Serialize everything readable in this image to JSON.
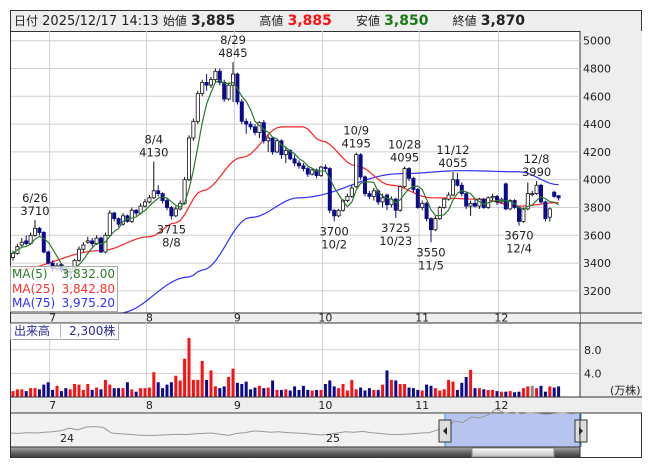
{
  "header": {
    "date_label": "日付",
    "date_value": "2025/12/17 14:13",
    "open_label": "始値",
    "open_value": "3,885",
    "high_label": "高値",
    "high_value": "3,885",
    "low_label": "安値",
    "low_value": "3,850",
    "close_label": "終値",
    "close_value": "3,870"
  },
  "legend": {
    "ma5_label": "MA(5)",
    "ma5_value": "3,832.00",
    "ma25_label": "MA(25)",
    "ma25_value": "3,842.80",
    "ma75_label": "MA(75)",
    "ma75_value": "3,975.20"
  },
  "volume_label": {
    "label": "出来高",
    "value": "2,300株"
  },
  "colors": {
    "up_fill": "#ffffff",
    "down_fill": "#0a0a8c",
    "ma5": "#2a7a2a",
    "ma25": "#ff2020",
    "ma75": "#3030ff",
    "vol_up": "#ff1010",
    "vol_down": "#0a0a8c",
    "vol_flat": "#888888"
  },
  "chart_data": {
    "type": "candlestick",
    "price_axis": {
      "min": 3100,
      "max": 5050,
      "ticks": [
        "5000",
        "4800",
        "4600",
        "4400",
        "4200",
        "4000",
        "3800",
        "3600",
        "3400",
        "3200"
      ]
    },
    "volume_axis": {
      "min": 0,
      "max": 11,
      "ticks": [
        "8.0",
        "4.0"
      ],
      "unit": "(万株)"
    },
    "months": [
      {
        "label": "7",
        "index": 9
      },
      {
        "label": "8",
        "index": 31
      },
      {
        "label": "9",
        "index": 51
      },
      {
        "label": "10",
        "index": 71
      },
      {
        "label": "11",
        "index": 93
      },
      {
        "label": "12",
        "index": 111
      }
    ],
    "ohlc": [
      [
        3440,
        3490,
        3420,
        3470
      ],
      [
        3470,
        3540,
        3460,
        3520
      ],
      [
        3530,
        3580,
        3510,
        3550
      ],
      [
        3560,
        3600,
        3530,
        3540
      ],
      [
        3540,
        3620,
        3530,
        3600
      ],
      [
        3600,
        3710,
        3590,
        3650
      ],
      [
        3650,
        3660,
        3600,
        3620
      ],
      [
        3620,
        3630,
        3470,
        3480
      ],
      [
        3480,
        3490,
        3390,
        3400
      ],
      [
        3400,
        3420,
        3340,
        3360
      ],
      [
        3360,
        3400,
        3340,
        3380
      ],
      [
        3390,
        3400,
        3330,
        3350
      ],
      [
        3350,
        3360,
        3300,
        3330
      ],
      [
        3330,
        3360,
        3310,
        3340
      ],
      [
        3340,
        3430,
        3330,
        3420
      ],
      [
        3420,
        3520,
        3410,
        3500
      ],
      [
        3500,
        3550,
        3480,
        3530
      ],
      [
        3550,
        3590,
        3540,
        3560
      ],
      [
        3560,
        3580,
        3520,
        3540
      ],
      [
        3540,
        3600,
        3530,
        3580
      ],
      [
        3580,
        3590,
        3470,
        3480
      ],
      [
        3480,
        3620,
        3470,
        3600
      ],
      [
        3600,
        3780,
        3590,
        3760
      ],
      [
        3760,
        3770,
        3700,
        3720
      ],
      [
        3720,
        3730,
        3660,
        3680
      ],
      [
        3680,
        3760,
        3670,
        3740
      ],
      [
        3740,
        3750,
        3690,
        3700
      ],
      [
        3700,
        3800,
        3690,
        3780
      ],
      [
        3780,
        3790,
        3740,
        3760
      ],
      [
        3760,
        3830,
        3750,
        3810
      ],
      [
        3810,
        3860,
        3800,
        3840
      ],
      [
        3840,
        3890,
        3830,
        3870
      ],
      [
        3870,
        4130,
        3860,
        3920
      ],
      [
        3920,
        3960,
        3880,
        3900
      ],
      [
        3900,
        3910,
        3830,
        3850
      ],
      [
        3850,
        3870,
        3780,
        3800
      ],
      [
        3800,
        3810,
        3715,
        3740
      ],
      [
        3740,
        3810,
        3730,
        3790
      ],
      [
        3790,
        3850,
        3780,
        3830
      ],
      [
        3830,
        4020,
        3820,
        4000
      ],
      [
        4000,
        4320,
        3990,
        4300
      ],
      [
        4300,
        4440,
        4280,
        4420
      ],
      [
        4420,
        4640,
        4400,
        4620
      ],
      [
        4620,
        4720,
        4600,
        4700
      ],
      [
        4700,
        4760,
        4640,
        4680
      ],
      [
        4680,
        4740,
        4660,
        4720
      ],
      [
        4720,
        4800,
        4700,
        4780
      ],
      [
        4780,
        4800,
        4680,
        4700
      ],
      [
        4700,
        4720,
        4560,
        4580
      ],
      [
        4580,
        4700,
        4570,
        4680
      ],
      [
        4680,
        4845,
        4560,
        4760
      ],
      [
        4760,
        4770,
        4540,
        4560
      ],
      [
        4560,
        4580,
        4400,
        4420
      ],
      [
        4420,
        4440,
        4330,
        4400
      ],
      [
        4400,
        4420,
        4360,
        4380
      ],
      [
        4380,
        4400,
        4320,
        4340
      ],
      [
        4340,
        4420,
        4300,
        4410
      ],
      [
        4410,
        4430,
        4260,
        4280
      ],
      [
        4280,
        4320,
        4200,
        4300
      ],
      [
        4300,
        4310,
        4180,
        4200
      ],
      [
        4200,
        4290,
        4190,
        4280
      ],
      [
        4280,
        4290,
        4150,
        4180
      ],
      [
        4180,
        4230,
        4120,
        4210
      ],
      [
        4210,
        4220,
        4140,
        4150
      ],
      [
        4150,
        4180,
        4100,
        4120
      ],
      [
        4120,
        4140,
        4080,
        4100
      ],
      [
        4100,
        4120,
        4060,
        4080
      ],
      [
        4080,
        4090,
        4020,
        4040
      ],
      [
        4040,
        4080,
        4030,
        4070
      ],
      [
        4070,
        4080,
        4010,
        4030
      ],
      [
        4030,
        4100,
        4020,
        4090
      ],
      [
        4090,
        4110,
        4060,
        4080
      ],
      [
        4080,
        4090,
        3760,
        3780
      ],
      [
        3780,
        3790,
        3700,
        3740
      ],
      [
        3740,
        3790,
        3730,
        3780
      ],
      [
        3780,
        3860,
        3770,
        3850
      ],
      [
        3850,
        3900,
        3840,
        3880
      ],
      [
        3880,
        3960,
        3870,
        3940
      ],
      [
        3950,
        4195,
        3940,
        4180
      ],
      [
        4180,
        4190,
        4000,
        4020
      ],
      [
        4020,
        4030,
        3880,
        3900
      ],
      [
        3900,
        3920,
        3860,
        3880
      ],
      [
        3880,
        3940,
        3850,
        3920
      ],
      [
        3920,
        3930,
        3820,
        3840
      ],
      [
        3840,
        3900,
        3800,
        3870
      ],
      [
        3890,
        3900,
        3780,
        3820
      ],
      [
        3820,
        3880,
        3800,
        3860
      ],
      [
        3860,
        3870,
        3725,
        3780
      ],
      [
        3780,
        3960,
        3770,
        3950
      ],
      [
        3950,
        4095,
        3940,
        4080
      ],
      [
        4080,
        4090,
        3990,
        4010
      ],
      [
        4010,
        4020,
        3910,
        3930
      ],
      [
        3930,
        3940,
        3790,
        3800
      ],
      [
        3800,
        3850,
        3780,
        3830
      ],
      [
        3830,
        3840,
        3700,
        3720
      ],
      [
        3720,
        3730,
        3550,
        3640
      ],
      [
        3640,
        3740,
        3630,
        3720
      ],
      [
        3720,
        3810,
        3710,
        3800
      ],
      [
        3800,
        3870,
        3790,
        3860
      ],
      [
        3860,
        3910,
        3850,
        3890
      ],
      [
        3890,
        4055,
        3880,
        4000
      ],
      [
        4000,
        4050,
        3950,
        3960
      ],
      [
        3960,
        3980,
        3880,
        3900
      ],
      [
        3900,
        3910,
        3790,
        3810
      ],
      [
        3810,
        3850,
        3740,
        3830
      ],
      [
        3830,
        3860,
        3800,
        3810
      ],
      [
        3810,
        3870,
        3790,
        3860
      ],
      [
        3860,
        3870,
        3790,
        3800
      ],
      [
        3800,
        3880,
        3790,
        3870
      ],
      [
        3870,
        3900,
        3850,
        3880
      ],
      [
        3880,
        3890,
        3820,
        3840
      ],
      [
        3840,
        3870,
        3830,
        3860
      ],
      [
        3970,
        3980,
        3780,
        3790
      ],
      [
        3790,
        3860,
        3780,
        3850
      ],
      [
        3850,
        3860,
        3790,
        3800
      ],
      [
        3800,
        3810,
        3670,
        3700
      ],
      [
        3700,
        3800,
        3690,
        3790
      ],
      [
        3790,
        3980,
        3780,
        3900
      ],
      [
        3900,
        3920,
        3880,
        3900
      ],
      [
        3900,
        3990,
        3890,
        3960
      ],
      [
        3960,
        3970,
        3830,
        3840
      ],
      [
        3840,
        3850,
        3700,
        3720
      ],
      [
        3730,
        3800,
        3700,
        3790
      ],
      [
        3910,
        3920,
        3870,
        3880
      ],
      [
        3885,
        3885,
        3850,
        3870
      ]
    ],
    "volume": [
      1.0,
      1.3,
      1.3,
      1.0,
      1.5,
      1.5,
      1.3,
      2.1,
      2.5,
      1.2,
      1.9,
      1.0,
      1.5,
      1.3,
      2.2,
      2.1,
      1.2,
      2.2,
      1.2,
      1.6,
      1.3,
      2.9,
      2.1,
      1.5,
      1.5,
      1.5,
      2.5,
      1.3,
      0.9,
      1.5,
      1.5,
      1.6,
      4.2,
      2.5,
      1.5,
      2.1,
      2.5,
      3.6,
      2.8,
      6.5,
      10.0,
      2.9,
      2.9,
      6.1,
      2.9,
      4.5,
      1.8,
      1.5,
      1.8,
      3.4,
      4.8,
      2.4,
      2.2,
      2.6,
      1.3,
      1.6,
      1.9,
      1.5,
      1.6,
      2.8,
      1.2,
      1.2,
      1.3,
      1.1,
      1.8,
      1.2,
      1.9,
      1.2,
      1.1,
      1.2,
      1.2,
      2.2,
      2.8,
      1.8,
      1.5,
      2.2,
      1.1,
      2.9,
      1.3,
      1.6,
      1.1,
      1.5,
      1.2,
      1.2,
      2.1,
      4.5,
      2.9,
      2.8,
      2.2,
      2.2,
      1.6,
      1.5,
      1.2,
      1.1,
      2.1,
      1.9,
      1.5,
      1.1,
      1.3,
      2.9,
      2.6,
      1.2,
      2.4,
      3.4,
      4.6,
      1.5,
      1.5,
      1.3,
      1.2,
      1.2,
      1.0,
      0.9,
      0.9,
      1.0,
      0.8,
      0.9,
      1.5,
      1.8,
      1.9,
      1.5,
      1.9,
      0.9,
      1.8,
      1.6,
      1.8,
      0.9
    ],
    "ma25": [
      [
        0,
        3350
      ],
      [
        20,
        3490
      ],
      [
        31,
        3590
      ],
      [
        37,
        3690
      ],
      [
        43,
        3920
      ],
      [
        52,
        4160
      ],
      [
        61,
        4380
      ],
      [
        66,
        4380
      ],
      [
        70,
        4280
      ],
      [
        78,
        4100
      ],
      [
        86,
        3960
      ],
      [
        95,
        3870
      ],
      [
        106,
        3860
      ],
      [
        115,
        3810
      ],
      [
        124,
        3835
      ]
    ],
    "ma75": [
      [
        24,
        3040
      ],
      [
        40,
        3300
      ],
      [
        43,
        3350
      ],
      [
        54,
        3728
      ],
      [
        65,
        3870
      ],
      [
        88,
        4043
      ],
      [
        102,
        4065
      ],
      [
        115,
        4057
      ],
      [
        124,
        3964
      ]
    ],
    "annotations": [
      {
        "index": 5,
        "date": "6/26",
        "price": "3710",
        "pos": "above"
      },
      {
        "index": 32,
        "date": "8/4",
        "price": "4130",
        "pos": "above"
      },
      {
        "index": 36,
        "date": "8/8",
        "price": "3715",
        "pos": "below"
      },
      {
        "index": 50,
        "date": "8/29",
        "price": "4845",
        "pos": "above"
      },
      {
        "index": 73,
        "date": "10/2",
        "price": "3700",
        "pos": "below"
      },
      {
        "index": 78,
        "date": "10/9",
        "price": "4195",
        "pos": "above"
      },
      {
        "index": 87,
        "date": "10/23",
        "price": "3725",
        "pos": "below"
      },
      {
        "index": 89,
        "date": "10/28",
        "price": "4095",
        "pos": "above"
      },
      {
        "index": 95,
        "date": "11/5",
        "price": "3550",
        "pos": "below"
      },
      {
        "index": 100,
        "date": "11/12",
        "price": "4055",
        "pos": "above"
      },
      {
        "index": 115,
        "date": "12/4",
        "price": "3670",
        "pos": "below"
      },
      {
        "index": 119,
        "date": "12/8",
        "price": "3990",
        "pos": "above"
      }
    ]
  },
  "navigator": {
    "year_labels": [
      "24",
      "25"
    ],
    "history": [
      3300,
      3290,
      3310,
      3300,
      3320,
      3330,
      3360,
      3420,
      3380,
      3450,
      3460,
      3440,
      3300,
      3280,
      3270,
      3250,
      3240,
      3240,
      3250,
      3260,
      3270,
      3260,
      3280,
      3290,
      3300,
      3270,
      3240,
      3290,
      3310,
      3350,
      3340,
      3320,
      3330,
      3310,
      3300,
      3290,
      3270,
      3250,
      3270,
      3300,
      3330,
      3320,
      3340,
      3310,
      3290,
      3270,
      3260,
      3270,
      3280,
      3300,
      3310,
      3380,
      3420,
      3600,
      3560,
      3700,
      3680,
      3750,
      3900,
      3800,
      3820,
      3780,
      3800,
      3790,
      3770,
      3790,
      3800,
      3780,
      3790
    ]
  }
}
